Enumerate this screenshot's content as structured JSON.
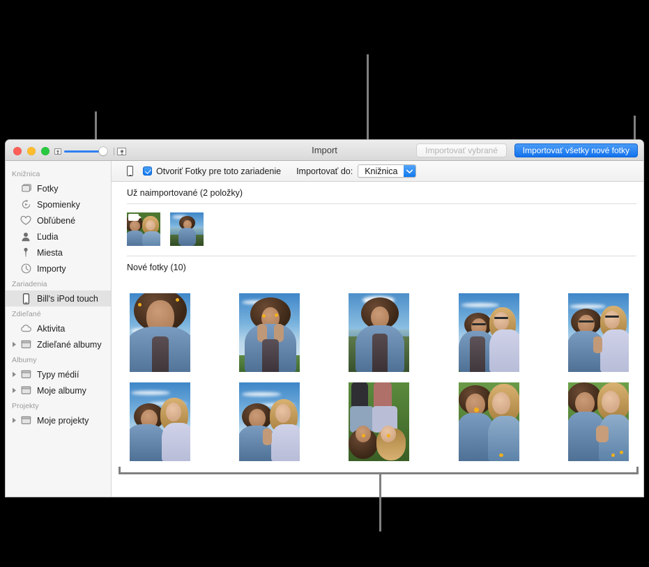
{
  "window": {
    "title": "Import",
    "traffic_lights": [
      "close",
      "minimize",
      "maximize"
    ],
    "zoom_slider": {
      "min_icon": "small-thumbnail-icon",
      "max_icon": "large-thumbnail-icon",
      "value_percent": 86
    },
    "toolbar": {
      "import_selected_label": "Importovať vybrané",
      "import_selected_enabled": false,
      "import_all_label": "Importovať všetky nové fotky",
      "import_all_color": "#1272ee"
    }
  },
  "device_bar": {
    "device_icon": "iphone-icon",
    "open_photos_checkbox": {
      "label": "Otvoriť Fotky pre toto zariadenie",
      "checked": true
    },
    "import_to_label": "Importovať do:",
    "import_to_value": "Knižnica",
    "import_to_options": [
      "Knižnica"
    ]
  },
  "sidebar": {
    "groups": [
      {
        "title": "Knižnica",
        "items": [
          {
            "label": "Fotky",
            "icon": "photos-stack-icon",
            "has_disclosure": false,
            "selected": false
          },
          {
            "label": "Spomienky",
            "icon": "memories-icon",
            "has_disclosure": false,
            "selected": false
          },
          {
            "label": "Obľúbené",
            "icon": "heart-icon",
            "has_disclosure": false,
            "selected": false
          },
          {
            "label": "Ľudia",
            "icon": "person-icon",
            "has_disclosure": false,
            "selected": false
          },
          {
            "label": "Miesta",
            "icon": "map-pin-icon",
            "has_disclosure": false,
            "selected": false
          },
          {
            "label": "Importy",
            "icon": "clock-icon",
            "has_disclosure": false,
            "selected": false
          }
        ]
      },
      {
        "title": "Zariadenia",
        "items": [
          {
            "label": "Bill's iPod touch",
            "icon": "ipod-touch-icon",
            "has_disclosure": false,
            "selected": true
          }
        ]
      },
      {
        "title": "Zdieľané",
        "items": [
          {
            "label": "Aktivita",
            "icon": "cloud-icon",
            "has_disclosure": false,
            "selected": false
          },
          {
            "label": "Zdieľané albumy",
            "icon": "album-icon",
            "has_disclosure": true,
            "selected": false
          }
        ]
      },
      {
        "title": "Albumy",
        "items": [
          {
            "label": "Typy médií",
            "icon": "album-icon",
            "has_disclosure": true,
            "selected": false
          },
          {
            "label": "Moje albumy",
            "icon": "album-icon",
            "has_disclosure": true,
            "selected": false
          }
        ]
      },
      {
        "title": "Projekty",
        "items": [
          {
            "label": "Moje projekty",
            "icon": "album-icon",
            "has_disclosure": true,
            "selected": false
          }
        ]
      }
    ]
  },
  "content": {
    "already_imported": {
      "heading": "Už naimportované (2 položky)",
      "count": 2,
      "items": [
        {
          "name": "two-girls-lying-grass-video",
          "is_video": true
        },
        {
          "name": "girl-by-the-sea",
          "is_video": false
        }
      ]
    },
    "new_photos": {
      "heading": "Nové fotky (10)",
      "count": 10,
      "items": [
        {
          "name": "girl-looking-up-sky"
        },
        {
          "name": "girl-flowers-over-eyes"
        },
        {
          "name": "girl-smiling-by-sea"
        },
        {
          "name": "two-friends-sunglasses-sky"
        },
        {
          "name": "two-friends-peace-sign-sky"
        },
        {
          "name": "two-friends-arm-out-sky"
        },
        {
          "name": "two-friends-peace-sign-closeup"
        },
        {
          "name": "two-friends-lying-grass-overhead"
        },
        {
          "name": "two-friends-lying-grass-flower"
        },
        {
          "name": "two-friends-lying-grass-smiling"
        }
      ]
    }
  },
  "callouts": {
    "sidebar_bracket": "sidebar-callout",
    "import_to_pointer": "import-to-callout",
    "import_all_pointer": "import-all-callout",
    "photo_grid_bracket": "photo-grid-callout"
  }
}
